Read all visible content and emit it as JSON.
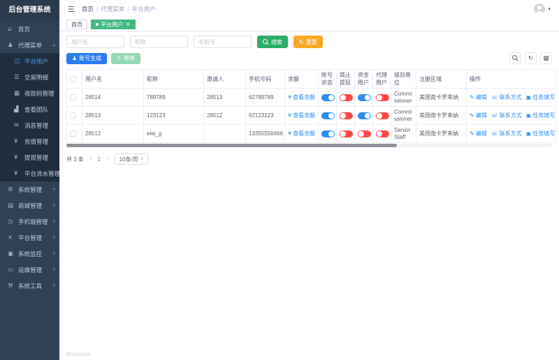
{
  "app": {
    "title": "后台管理系统",
    "footer": "BOSSENG"
  },
  "icons": {
    "hamburger": "☰",
    "caret_down": "▾",
    "caret_up": "▴",
    "home": "⌂",
    "agent": "♟",
    "platform_user": "◫",
    "transaction": "☰",
    "qrcode": "▦",
    "team": "▟",
    "message": "✉",
    "recharge": "¥",
    "withdraw": "¥",
    "flow": "¥",
    "system": "⚙",
    "mall": "▤",
    "mobile": "◷",
    "platform": "×",
    "monitor": "▣",
    "ops": "▭",
    "tools": "⚒",
    "yen": "¥",
    "edit": "✎",
    "phone": "☏",
    "task": "▣",
    "refresh": "↻",
    "grid": "▦",
    "close": "×",
    "prev": "‹",
    "next": "›"
  },
  "sidebar": {
    "menu": {
      "home": "首页",
      "agent": "代理菜单",
      "sub": [
        "平台用户",
        "交易明细",
        "收款码管理",
        "查看团队",
        "消息管理",
        "充值管理",
        "提现管理",
        "平台流水管理"
      ],
      "groups": [
        "系统管理",
        "商城管理",
        "手机端管理",
        "平台管理",
        "系统监控",
        "运维管理",
        "系统工具"
      ]
    }
  },
  "header": {
    "breadcrumb": [
      "首页",
      "代理菜单",
      "平台用户"
    ]
  },
  "tabs": {
    "home": "首页",
    "active": "平台用户"
  },
  "filters": {
    "username": "用户名",
    "nickname": "昵称",
    "phone": "手机号",
    "search": "搜索",
    "reset": "重置"
  },
  "toolbar": {
    "generate": "账号生成",
    "modify": "修改"
  },
  "table": {
    "headers": [
      "用户名",
      "昵称",
      "邀请人",
      "手机号码",
      "余额",
      "账号状态",
      "禁止提现",
      "资金用户",
      "代理用户",
      "级别单位",
      "注册区域",
      "操作"
    ],
    "balance_action": "查看余额",
    "actions": {
      "edit": "编辑",
      "contact": "联系方式",
      "task": "任务填写"
    },
    "rows": [
      {
        "username": "28514",
        "nickname": "789789",
        "inviter": "28513",
        "phone": "62789789",
        "level": "Commissioner",
        "region": "美国南卡罗来纳",
        "toggles": {
          "account_status": true,
          "ban_withdraw": false,
          "fund_user": true,
          "agent_user": false
        }
      },
      {
        "username": "28513",
        "nickname": "123123",
        "inviter": "28512",
        "phone": "62123123",
        "level": "Commissioner",
        "region": "美国南卡罗来纳",
        "toggles": {
          "account_status": true,
          "ban_withdraw": false,
          "fund_user": true,
          "agent_user": false
        }
      },
      {
        "username": "28512",
        "nickname": "eiei_g",
        "inviter": "",
        "phone": "13355556666",
        "level": "Senior Staff",
        "region": "美国南卡罗来纳",
        "toggles": {
          "account_status": true,
          "ban_withdraw": false,
          "fund_user": false,
          "agent_user": false
        }
      }
    ]
  },
  "pagination": {
    "total": "共 3 条",
    "page": "1",
    "size": "10条/页"
  },
  "colors": {
    "accent_green": "#42b983",
    "accent_blue": "#2d8cf0",
    "toggle_on": "#2d8cf0",
    "toggle_off": "#ff4949",
    "sidebar_bg": "#304156",
    "submenu_bg": "#1f2d3d",
    "warning": "#f9a825"
  }
}
